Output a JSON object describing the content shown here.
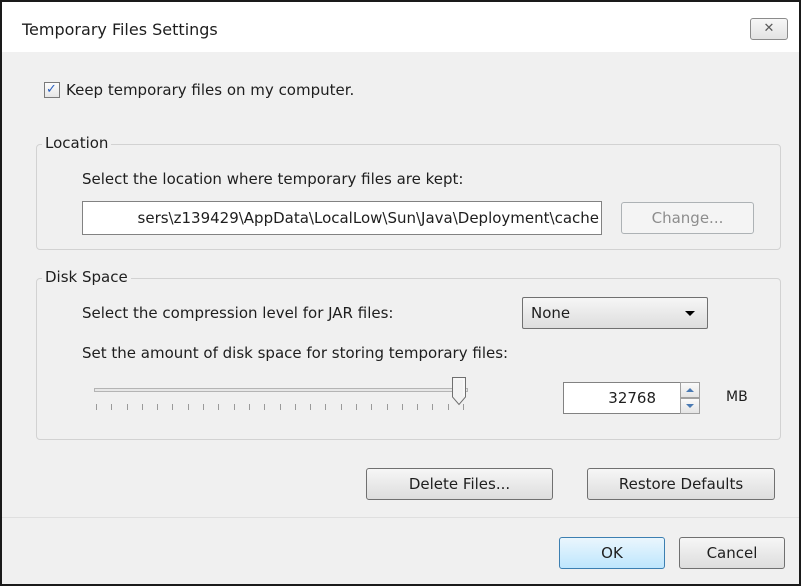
{
  "window": {
    "title": "Temporary Files Settings",
    "close_glyph": "✕"
  },
  "keep_files": {
    "label": "Keep temporary files on my computer.",
    "checked": true
  },
  "location": {
    "legend": "Location",
    "instruction": "Select the location where temporary files are kept:",
    "path_value": "sers\\z139429\\AppData\\LocalLow\\Sun\\Java\\Deployment\\cache",
    "change_button": "Change..."
  },
  "disk_space": {
    "legend": "Disk Space",
    "compression_label": "Select the compression level for JAR files:",
    "compression_selected": "None",
    "amount_label": "Set the amount of disk space for storing temporary files:",
    "amount_value": "32768",
    "unit": "MB",
    "slider_level_fraction": 1.0
  },
  "actions": {
    "delete_files": "Delete Files...",
    "restore_defaults": "Restore Defaults",
    "ok": "OK",
    "cancel": "Cancel"
  },
  "colors": {
    "checkmark": "#2a5fbf",
    "spinner_arrow": "#4a7ab3",
    "default_button": "#bee6fd"
  }
}
